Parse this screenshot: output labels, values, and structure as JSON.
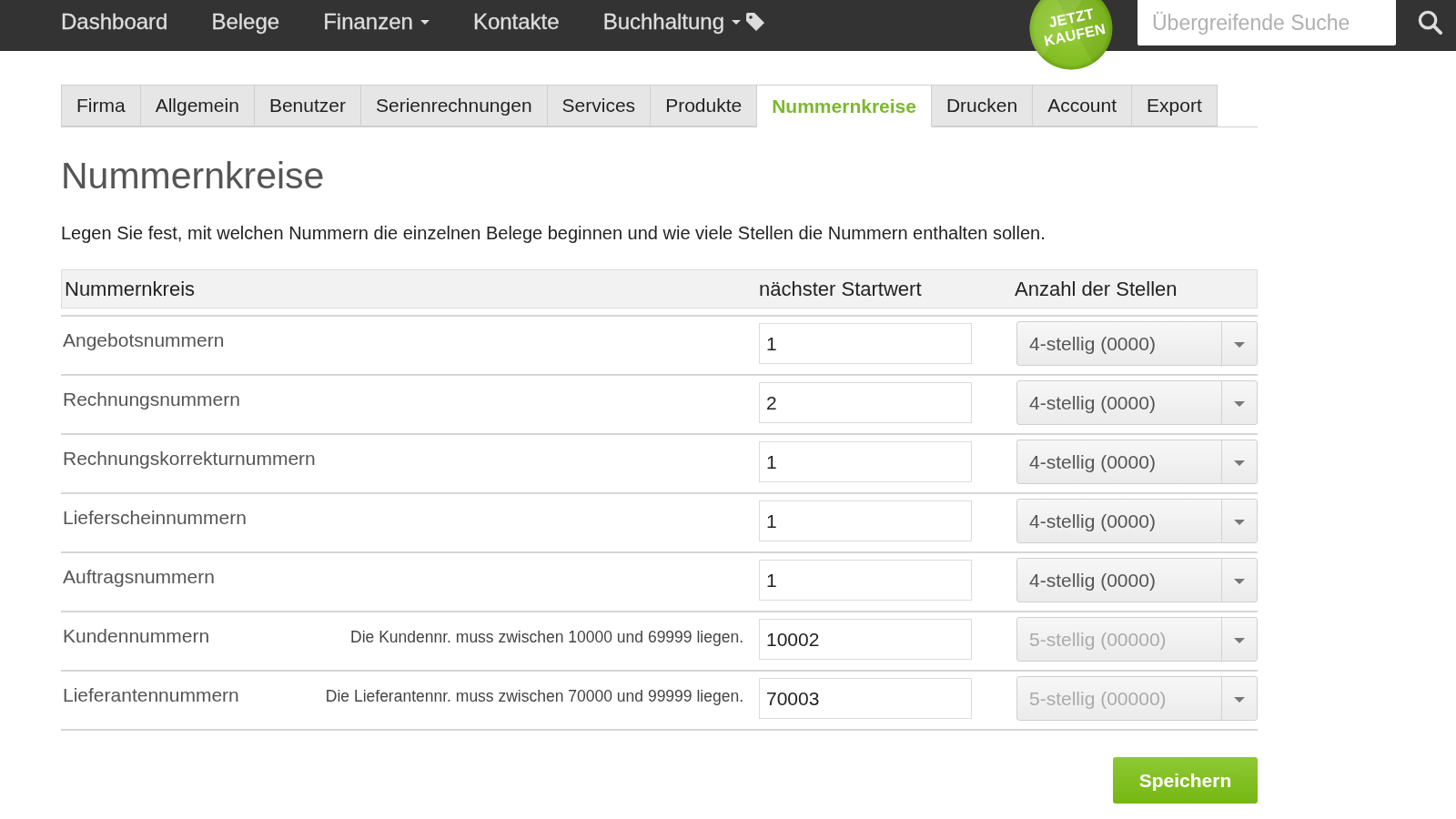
{
  "top_nav": {
    "items": [
      {
        "label": "Dashboard",
        "dropdown": false,
        "tag_icon": false
      },
      {
        "label": "Belege",
        "dropdown": false,
        "tag_icon": false
      },
      {
        "label": "Finanzen",
        "dropdown": true,
        "tag_icon": false
      },
      {
        "label": "Kontakte",
        "dropdown": false,
        "tag_icon": false
      },
      {
        "label": "Buchhaltung",
        "dropdown": true,
        "tag_icon": true
      }
    ],
    "promo_badge": {
      "lines": [
        "JETZT",
        "KAUFEN"
      ]
    },
    "search": {
      "placeholder": "Übergreifende Suche"
    }
  },
  "tabs": [
    {
      "label": "Firma",
      "selected": false
    },
    {
      "label": "Allgemein",
      "selected": false
    },
    {
      "label": "Benutzer",
      "selected": false
    },
    {
      "label": "Serienrechnungen",
      "selected": false
    },
    {
      "label": "Services",
      "selected": false
    },
    {
      "label": "Produkte",
      "selected": false
    },
    {
      "label": "Nummernkreise",
      "selected": true
    },
    {
      "label": "Drucken",
      "selected": false
    },
    {
      "label": "Account",
      "selected": false
    },
    {
      "label": "Export",
      "selected": false
    }
  ],
  "page": {
    "title": "Nummernkreise",
    "description": "Legen Sie fest, mit welchen Nummern die einzelnen Belege beginnen und wie viele Stellen die Nummern enthalten sollen."
  },
  "table": {
    "columns": [
      "Nummernkreis",
      "nächster Startwert",
      "Anzahl der Stellen"
    ],
    "rows": [
      {
        "name": "Angebotsnummern",
        "start_value": "1",
        "digits": {
          "value": "4-stellig (0000)",
          "disabled": false
        }
      },
      {
        "name": "Rechnungsnummern",
        "start_value": "2",
        "digits": {
          "value": "4-stellig (0000)",
          "disabled": false
        }
      },
      {
        "name": "Rechnungskorrekturnummern",
        "start_value": "1",
        "digits": {
          "value": "4-stellig (0000)",
          "disabled": false
        }
      },
      {
        "name": "Lieferscheinnummern",
        "start_value": "1",
        "digits": {
          "value": "4-stellig (0000)",
          "disabled": false
        }
      },
      {
        "name": "Auftragsnummern",
        "start_value": "1",
        "digits": {
          "value": "4-stellig (0000)",
          "disabled": false
        }
      },
      {
        "name": "Kundennummern",
        "hint": "Die Kundennr. muss zwischen 10000 und 69999 liegen.",
        "start_value": "10002",
        "digits": {
          "value": "5-stellig (00000)",
          "disabled": true
        }
      },
      {
        "name": "Lieferantennummern",
        "hint": "Die Lieferantennr. muss zwischen 70000 und 99999 liegen.",
        "start_value": "70003",
        "digits": {
          "value": "5-stellig (00000)",
          "disabled": true
        }
      }
    ]
  },
  "save_button": {
    "label": "Speichern"
  }
}
